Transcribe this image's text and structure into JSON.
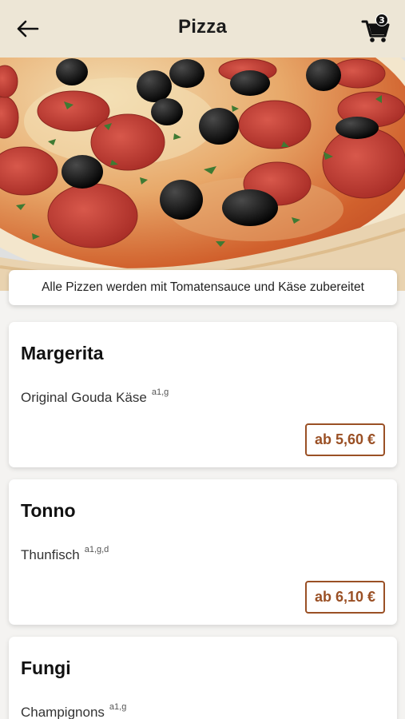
{
  "header": {
    "title": "Pizza",
    "back_icon": "arrow-left-icon",
    "cart_icon": "shopping-cart-icon",
    "cart_count": "3"
  },
  "hero": {
    "image": "pepperoni-olive-pizza-photo"
  },
  "notice": "Alle Pizzen werden mit Tomatensauce und Käse zubereitet",
  "menu": [
    {
      "name": "Margerita",
      "description": "Original Gouda Käse",
      "allergens": "a1,g",
      "price": "ab 5,60 €"
    },
    {
      "name": "Tonno",
      "description": "Thunfisch",
      "allergens": "a1,g,d",
      "price": "ab 6,10 €"
    },
    {
      "name": "Fungi",
      "description": "Champignons",
      "allergens": "a1,g"
    }
  ],
  "colors": {
    "header_bg": "#ede6d6",
    "accent": "#9a5025",
    "page_bg": "#f4f3f1"
  }
}
